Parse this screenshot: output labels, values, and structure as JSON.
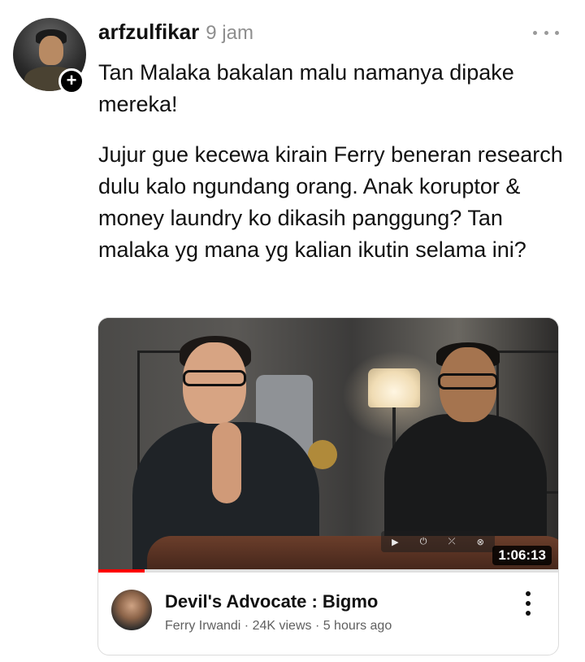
{
  "post": {
    "username": "arfzulfikar",
    "timestamp": "9 jam",
    "paragraphs": [
      "Tan Malaka bakalan malu namanya dipake mereka!",
      "Jujur gue kecewa kirain Ferry beneran research dulu kalo ngundang orang. Anak koruptor & money laundry ko dikasih panggung? Tan malaka yg mana yg kalian ikutin selama ini?"
    ],
    "follow_badge": "+",
    "icons": {
      "avatar": "user-avatar",
      "follow": "plus-icon",
      "more": "more-horizontal-icon"
    }
  },
  "video_card": {
    "duration": "1:06:13",
    "progress_fraction": 0.1,
    "title": "Devil's Advocate : Bigmo",
    "meta": "Ferry Irwandi · 24K views · 5 hours ago",
    "controls": [
      "▶",
      "⏻",
      "⤫",
      "⊗"
    ],
    "icons": {
      "more": "more-vertical-icon",
      "channel": "channel-avatar"
    },
    "colors": {
      "progress": "#ff0000"
    }
  }
}
